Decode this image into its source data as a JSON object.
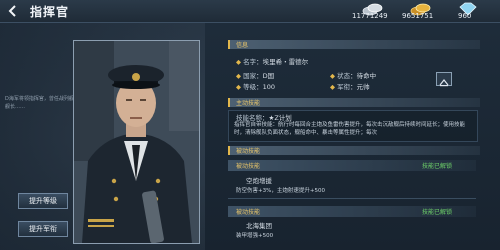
{
  "header": {
    "title": "指挥官"
  },
  "currencies": [
    {
      "icon": "silver-coin-icon",
      "value": "11771249"
    },
    {
      "icon": "gold-coin-icon",
      "value": "9651751"
    },
    {
      "icon": "diamond-icon",
      "value": "960"
    }
  ],
  "left": {
    "bio": "D海军将领指挥官，曾任战列舰舰长……",
    "buttons": {
      "upgrade_level": "提升等级",
      "upgrade_rank": "提升军衔"
    }
  },
  "profile": {
    "section_title": "信息",
    "name_label": "名字",
    "name_value": "埃里希・雷德尔",
    "country_label": "国家",
    "country_value": "D国",
    "status_label": "状态",
    "status_value": "待命中",
    "level_label": "等级",
    "level_value": "100",
    "rank_label": "军衔",
    "rank_value": "元帅"
  },
  "active_skill": {
    "section_title": "主动技能",
    "name_label": "技能名称",
    "name_value": "★Z计划",
    "description": "指挥官自带技能：航行时每回合主炮及鱼雷伤害提升，每次击沉敌舰后持续时间延长；使用技能时，清除舰队负面状态，舰船命中、暴击等属性提升；每次"
  },
  "passive_skills": {
    "section_title": "被动技能",
    "items": [
      {
        "header": "被动技能",
        "status": "技能已解锁",
        "name": "空炮增援",
        "desc": "防空伤害+3%，主炮射速提升+500"
      },
      {
        "header": "被动技能",
        "status": "技能已解锁",
        "name": "北海集团",
        "desc": "装甲增强+500"
      }
    ]
  },
  "colors": {
    "accent_gold": "#e2b74c",
    "status_green": "#6fd36a"
  }
}
